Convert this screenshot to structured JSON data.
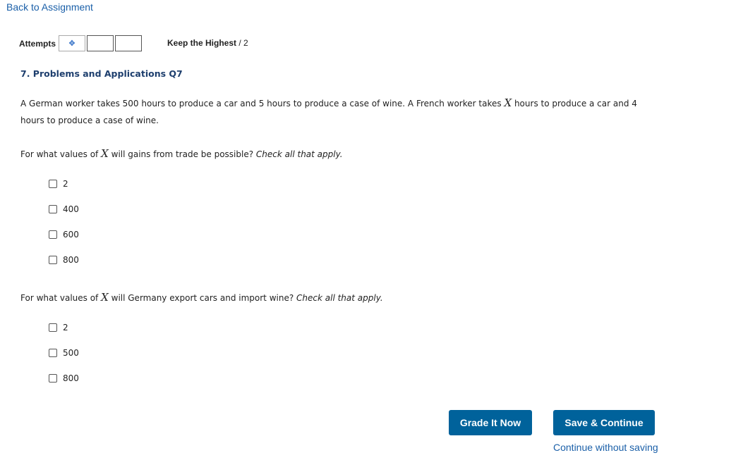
{
  "nav": {
    "back_link": "Back to Assignment"
  },
  "attempts": {
    "label": "Attempts",
    "keep_label": "Keep the Highest",
    "max": "/ 2"
  },
  "question": {
    "title": "7. Problems and Applications Q7",
    "intro_part1": "A German worker takes 500 hours to produce a car and 5 hours to produce a case of wine. A French worker takes",
    "var": "X",
    "intro_part2": "hours to produce a car and 4",
    "intro_line2": "hours to produce a case of wine."
  },
  "part1": {
    "prompt_pre": "For what values of",
    "var": "X",
    "prompt_post": "will gains from trade be possible?",
    "instruction": "Check all that apply.",
    "options": [
      "2",
      "400",
      "600",
      "800"
    ]
  },
  "part2": {
    "prompt_pre": "For what values of",
    "var": "X",
    "prompt_post": "will Germany export cars and import wine?",
    "instruction": "Check all that apply.",
    "options": [
      "2",
      "500",
      "800"
    ]
  },
  "actions": {
    "grade_label": "Grade It Now",
    "save_label": "Save & Continue",
    "continue_label": "Continue without saving"
  },
  "colors": {
    "link": "#1a5fa8",
    "title": "#1e3f6e",
    "button": "#00629b"
  }
}
